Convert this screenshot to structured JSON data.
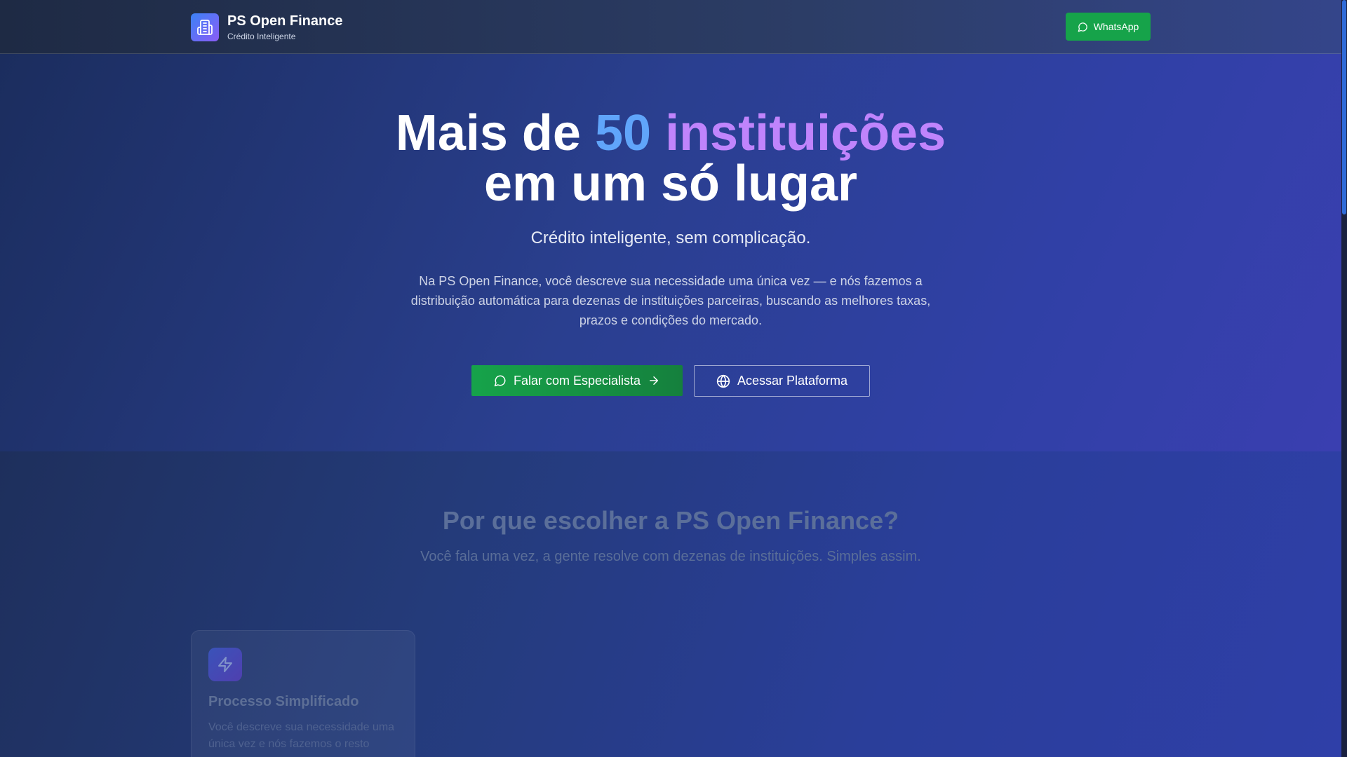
{
  "header": {
    "brand_title": "PS Open Finance",
    "brand_subtitle": "Crédito Inteligente",
    "whatsapp_label": "WhatsApp"
  },
  "hero": {
    "title_part1": "Mais de ",
    "title_highlight_num": "50",
    "title_highlight_word": "instituições",
    "title_line2": "em um só lugar",
    "subtitle": "Crédito inteligente, sem complicação.",
    "description": "Na PS Open Finance, você descreve sua necessidade uma única vez — e nós fazemos a distribuição automática para dezenas de instituições parceiras, buscando as melhores taxas, prazos e condições do mercado.",
    "primary_button": "Falar com Especialista",
    "secondary_button": "Acessar Plataforma"
  },
  "why": {
    "title": "Por que escolher a PS Open Finance?",
    "subtitle": "Você fala uma vez, a gente resolve com dezenas de instituições. Simples assim.",
    "cards": [
      {
        "icon": "lightning-icon",
        "title": "Processo Simplificado",
        "text": "Você descreve sua necessidade uma única vez e nós fazemos o resto"
      }
    ]
  },
  "colors": {
    "accent_green": "#16a34a",
    "highlight_blue": "#60a5fa",
    "highlight_purple": "#c084fc"
  },
  "icons": {
    "logo": "building-icon",
    "whatsapp": "chat-bubble-icon",
    "arrow": "arrow-right-icon",
    "globe": "globe-icon"
  }
}
